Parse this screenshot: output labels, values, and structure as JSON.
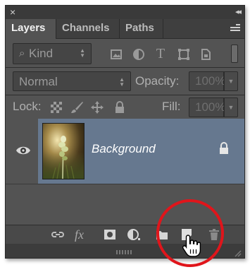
{
  "panel": {
    "close_glyph": "×",
    "collapse_glyph": "◂◂",
    "tabs": [
      {
        "label": "Layers",
        "active": true
      },
      {
        "label": "Channels",
        "active": false
      },
      {
        "label": "Paths",
        "active": false
      }
    ],
    "menu_icon": "panel-menu-icon"
  },
  "filter": {
    "kind_label": "Kind",
    "search_glyph": "⌕",
    "icons": [
      "pixel-filter-icon",
      "adjustment-filter-icon",
      "type-filter-icon",
      "shape-filter-icon",
      "smart-object-filter-icon"
    ],
    "type_glyph": "T"
  },
  "blend": {
    "mode": "Normal",
    "opacity_label": "Opacity:",
    "opacity_value": "100%"
  },
  "lock": {
    "label": "Lock:",
    "icons": [
      "lock-transparent-pixels-icon",
      "lock-image-pixels-icon",
      "lock-position-icon",
      "lock-all-icon"
    ],
    "fill_label": "Fill:",
    "fill_value": "100%"
  },
  "layers": [
    {
      "name": "Background",
      "visible": true,
      "locked": true,
      "selected": true
    }
  ],
  "bottom_icons": [
    "link-layers-icon",
    "layer-style-icon",
    "layer-mask-icon",
    "adjustment-layer-icon",
    "new-group-icon",
    "new-layer-icon",
    "delete-layer-icon"
  ],
  "fx_glyph": "fx",
  "colors": {
    "panel_bg": "#535353",
    "selection": "#66788f",
    "highlight_circle": "#e0151b"
  }
}
